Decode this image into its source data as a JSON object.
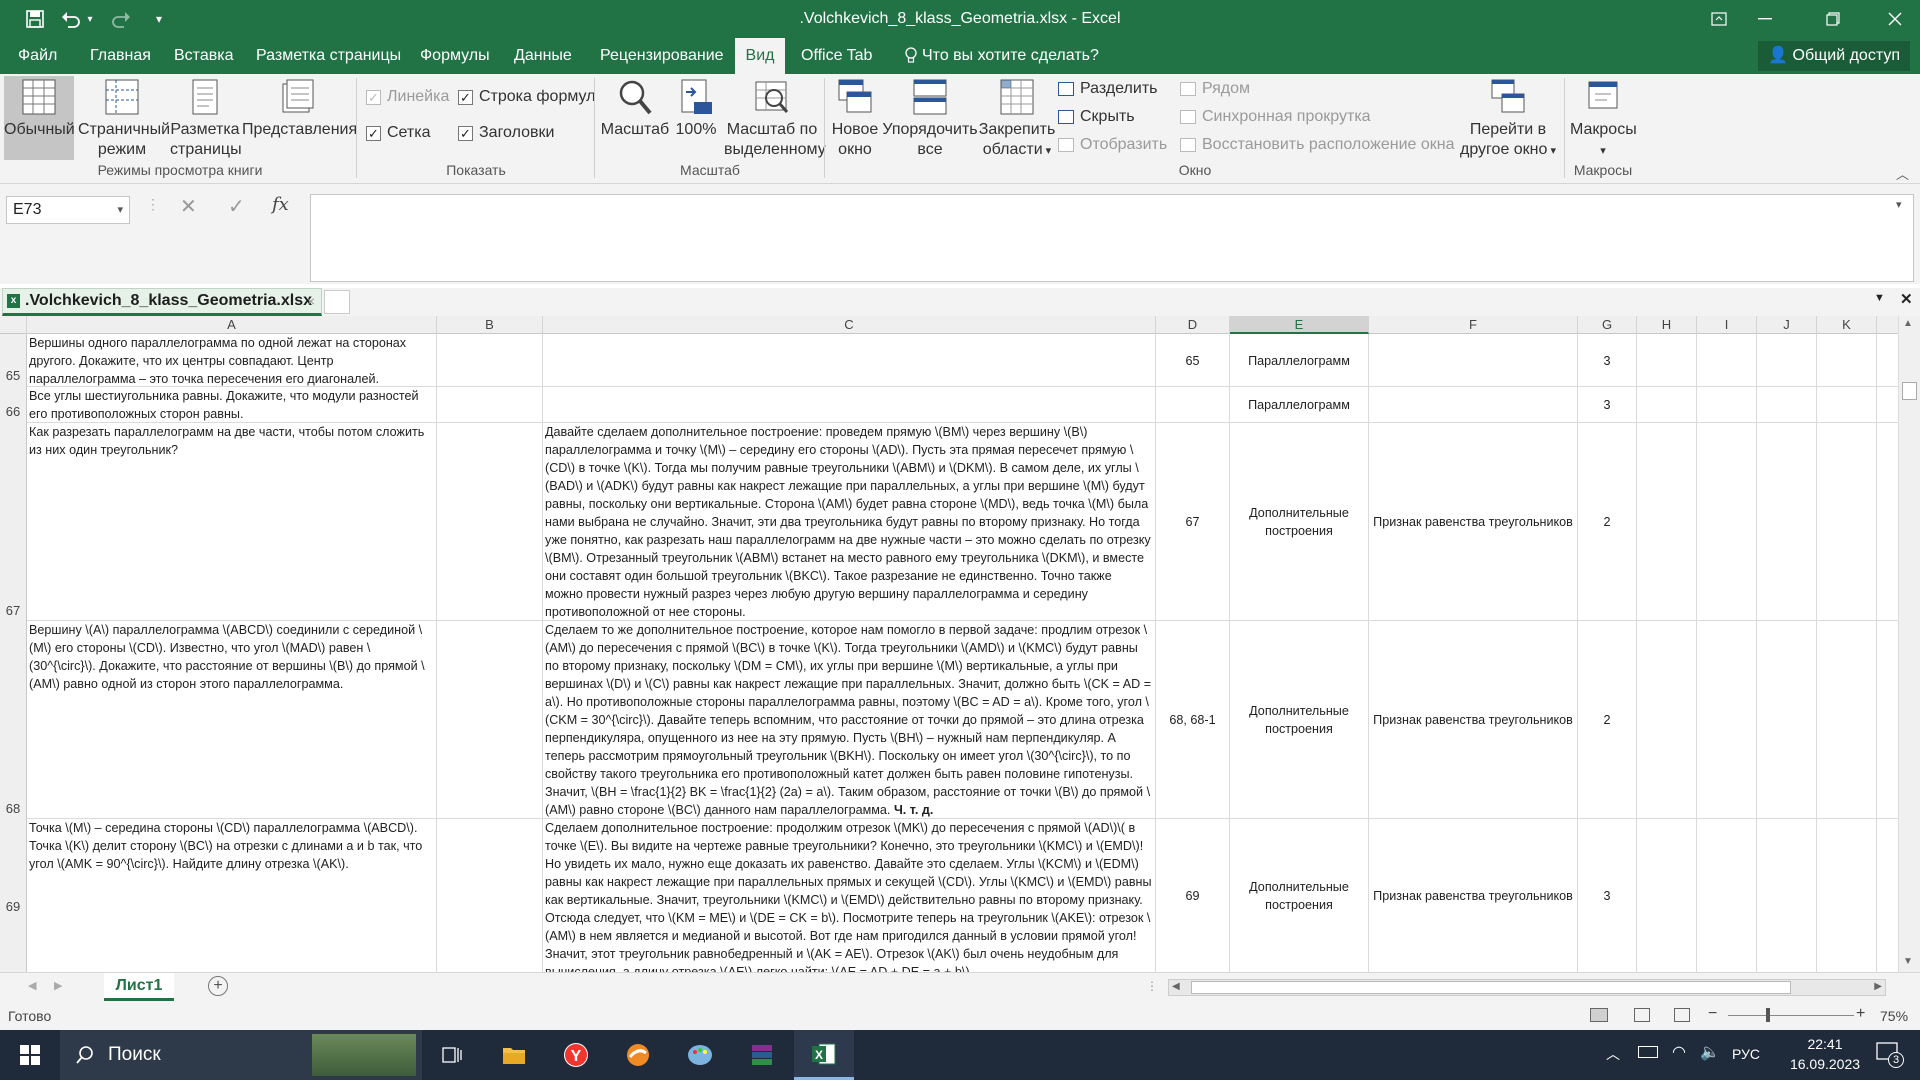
{
  "window": {
    "title": ".Volchkevich_8_klass_Geometria.xlsx  -  Excel",
    "quick_access": [
      "save-icon",
      "undo-icon",
      "redo-icon",
      "customize-icon"
    ]
  },
  "tabs": [
    "Файл",
    "Главная",
    "Вставка",
    "Разметка страницы",
    "Формулы",
    "Данные",
    "Рецензирование",
    "Вид",
    "Office Tab"
  ],
  "active_tab": "Вид",
  "tell_me": "Что вы хотите сделать?",
  "share": "Общий доступ",
  "ribbon": {
    "views": {
      "normal": "Обычный",
      "page_break_1": "Страничный",
      "page_break_2": "режим",
      "layout_1": "Разметка",
      "layout_2": "страницы",
      "custom": "Представления",
      "group": "Режимы просмотра книги"
    },
    "show": {
      "ruler": "Линейка",
      "formula_bar": "Строка формул",
      "gridlines": "Сетка",
      "headings": "Заголовки",
      "group": "Показать"
    },
    "zoom": {
      "zoom": "Масштаб",
      "z100": "100%",
      "zsel_1": "Масштаб по",
      "zsel_2": "выделенному",
      "group": "Масштаб"
    },
    "window": {
      "new_1": "Новое",
      "new_2": "окно",
      "arrange_1": "Упорядочить",
      "arrange_2": "все",
      "freeze_1": "Закрепить",
      "freeze_2": "области",
      "split": "Разделить",
      "hide": "Скрыть",
      "unhide": "Отобразить",
      "side": "Рядом",
      "sync": "Синхронная прокрутка",
      "reset": "Восстановить расположение окна",
      "switch_1": "Перейти в",
      "switch_2": "другое окно",
      "group": "Окно"
    },
    "macros": {
      "label": "Макросы",
      "group": "Макросы"
    }
  },
  "formula_bar": {
    "name_box": "E73",
    "formula": "",
    "fx": "fx"
  },
  "doc_tab": ".Volchkevich_8_klass_Geometria.xlsx",
  "columns": [
    "A",
    "B",
    "C",
    "D",
    "E",
    "F",
    "G",
    "H",
    "I",
    "J",
    "K"
  ],
  "rows": [
    {
      "num": "65",
      "a": "Вершины одного параллелограмма по одной лежат на сторонах другого. Докажите, что их центры совпадают. Центр параллелограмма – это точка пересечения его диагоналей.",
      "c": "",
      "d": "65",
      "e": "Параллелограмм",
      "f": "",
      "g": "3"
    },
    {
      "num": "66",
      "a": "Все углы шестиугольника равны. Докажите, что модули разностей его противоположных сторон равны.",
      "c": "",
      "d": "",
      "e": "Параллелограмм",
      "f": "",
      "g": "3"
    },
    {
      "num": "67",
      "a": "Как разрезать параллелограмм на две части, чтобы потом сложить из них один треугольник?",
      "c": "Давайте сделаем дополнительное построение: проведем прямую \\(BM\\) через вершину \\(B\\) параллелограмма и точку \\(M\\) – середину его стороны \\(AD\\). Пусть эта прямая пересечет прямую \\(CD\\) в точке \\(K\\). Тогда мы получим равные треугольники \\(ABM\\) и \\(DKM\\). В самом деле, их углы \\(BAD\\) и \\(ADK\\) будут равны как накрест лежащие при параллельных, а углы при вершине \\(M\\) будут равны, поскольку они вертикальные. Сторона \\(AM\\) будет равна стороне \\(MD\\), ведь точка \\(M\\) была нами выбрана не случайно. Значит, эти два треугольника будут равны по второму признаку. Но тогда уже понятно, как разрезать наш параллелограмм на две нужные части – это можно сделать по отрезку \\(BM\\). Отрезанный треугольник \\(ABM\\) встанет на место равного ему треугольника \\(DKM\\), и вместе они составят один большой треугольник \\(BKC\\). Такое разрезание не единственно. Точно также можно провести нужный разрез через любую другую вершину параллелограмма и середину противоположной от нее стороны.",
      "d": "67",
      "e": "Дополнительные построения",
      "f": "Признак равенства треугольников",
      "g": "2"
    },
    {
      "num": "68",
      "a": "Вершину \\(A\\) параллелограмма \\(ABCD\\) соединили с серединой \\(M\\) его стороны \\(CD\\). Известно, что угол \\(MAD\\) равен \\(30^{\\circ}\\). Докажите, что расстояние от вершины \\(B\\) до прямой \\(AM\\) равно одной из сторон этого параллелограмма.",
      "c": "Сделаем то же дополнительное построение, которое нам помогло в первой задаче: продлим отрезок \\(AM\\) до пересечения с прямой \\(BC\\) в точке \\(K\\). Тогда треугольники \\(AMD\\) и \\(KMC\\) будут равны по второму признаку, поскольку \\(DM = CM\\), их углы при вершине \\(M\\) вертикальные, а углы при вершинах \\(D\\) и \\(C\\) равны как накрест лежащие при параллельных. Значит, должно быть \\(CK = AD = a\\). Но противоположные стороны параллелограмма равны, поэтому \\(BC = AD = a\\). Кроме того, угол \\(CKM = 30^{\\circ}\\). Давайте теперь вспомним, что расстояние от точки до прямой – это длина отрезка перпендикуляра, опущенного из нее на эту прямую. Пусть \\(BH\\) – нужный нам перпендикуляр. А теперь рассмотрим прямоугольный треугольник \\(BKH\\). Поскольку он имеет угол \\(30^{\\circ}\\), то по свойству такого треугольника его противоположный катет должен быть равен половине гипотенузы. Значит, \\(BH = \\frac{1}{2} BK = \\frac{1}{2} (2a) = a\\). Таким образом, расстояние от точки \\(B\\) до прямой \\(AM\\) равно стороне \\(BC\\) данного нам параллелограмма.",
      "c_bold": "Ч. т. д.",
      "d": "68, 68-1",
      "e": "Дополнительные построения",
      "f": "Признак равенства треугольников",
      "g": "2"
    },
    {
      "num": "69",
      "a": "Точка \\(M\\) – середина стороны \\(CD\\) параллелограмма \\(ABCD\\). Точка \\(K\\) делит сторону \\(BC\\) на отрезки с длинами a и b так, что угол \\(AMK = 90^{\\circ}\\). Найдите длину отрезка \\(AK\\).",
      "c": "Сделаем дополнительное построение: продолжим отрезок \\(MK\\) до пересечения с прямой \\(AD\\)\\( в точке \\(E\\). Вы видите на чертеже равные треугольники? Конечно, это треугольники \\(KMC\\) и \\(EMD\\)! Но увидеть их мало, нужно еще доказать их равенство. Давайте это сделаем. Углы \\(KCM\\) и \\(EDM\\) равны как накрест лежащие при параллельных прямых и секущей \\(CD\\). Углы \\(KMC\\) и \\(EMD\\) равны как вертикальные. Значит, треугольники \\(KMC\\) и \\(EMD\\) действительно равны по второму признаку. Отсюда следует, что \\(KM = ME\\) и \\(DE = CK = b\\). Посмотрите теперь на треугольник \\(AKE\\): отрезок \\(AM\\) в нем является и медианой и высотой. Вот где нам пригодился данный в условии прямой угол! Значит, этот треугольник равнобедренный и \\(AK = AE\\). Отрезок \\(AK\\) был очень неудобным для вычисления, а длину отрезка \\(AE\\) легко найти: \\(AE = AD + DE = a + b\\).",
      "d": "69",
      "e": "Дополнительные построения",
      "f": "Признак равенства треугольников",
      "g": "3"
    }
  ],
  "sheet_tab": "Лист1",
  "status": {
    "ready": "Готово",
    "zoom": "75%"
  },
  "taskbar": {
    "search": "Поиск",
    "lang": "РУС",
    "time": "22:41",
    "date": "16.09.2023",
    "notif": "3"
  }
}
